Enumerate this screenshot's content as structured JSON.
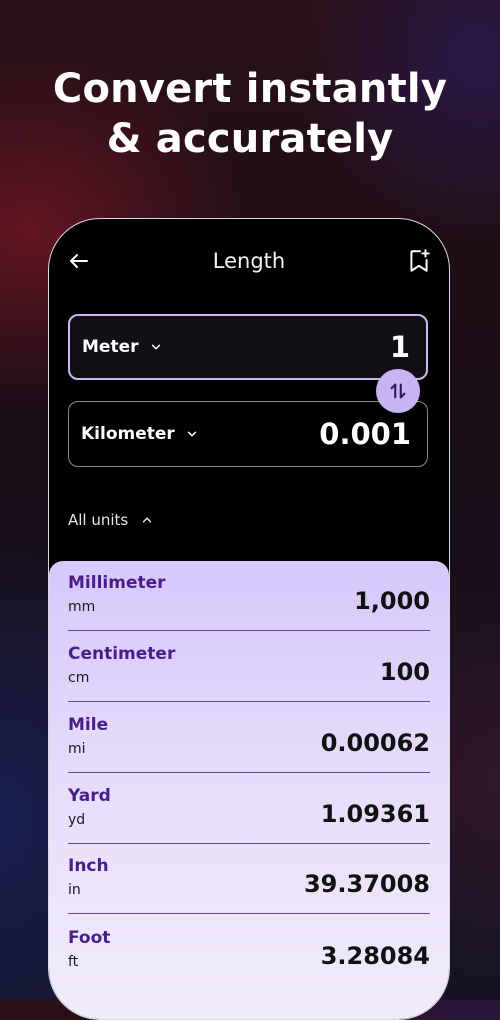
{
  "headline": {
    "line1": "Convert instantly",
    "line2": "& accurately"
  },
  "toolbar": {
    "title": "Length",
    "back_icon": "arrow-left-icon",
    "bookmark_icon": "bookmark-add-icon"
  },
  "converter": {
    "from": {
      "unit": "Meter",
      "value": "1"
    },
    "to": {
      "unit": "Kilometer",
      "value": "0.001"
    },
    "swap_icon": "swap-vertical-icon"
  },
  "all_units": {
    "label": "All units",
    "expanded": true
  },
  "units": [
    {
      "name": "Millimeter",
      "abbr": "mm",
      "value": "1,000"
    },
    {
      "name": "Centimeter",
      "abbr": "cm",
      "value": "100"
    },
    {
      "name": "Mile",
      "abbr": "mi",
      "value": "0.00062"
    },
    {
      "name": "Yard",
      "abbr": "yd",
      "value": "1.09361"
    },
    {
      "name": "Inch",
      "abbr": "in",
      "value": "39.37008"
    },
    {
      "name": "Foot",
      "abbr": "ft",
      "value": "3.28084"
    }
  ],
  "colors": {
    "accent": "#c7b4f3",
    "unit_name": "#4a1d8a",
    "divider": "#6b3fa8"
  }
}
